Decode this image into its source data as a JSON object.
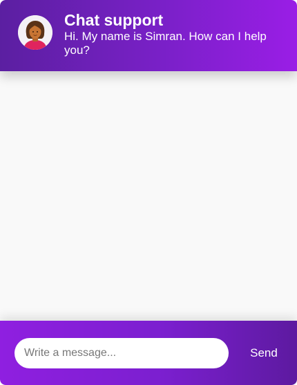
{
  "header": {
    "title": "Chat support",
    "subtitle": "Hi. My name is Simran. How can I help you?",
    "avatar_icon": "woman-avatar-icon"
  },
  "composer": {
    "placeholder": "Write a message...",
    "value": "",
    "send_label": "Send"
  },
  "colors": {
    "header_start": "#5b1fa1",
    "header_end": "#9a1ee6",
    "footer_start": "#8f1fe0",
    "footer_end": "#5d1aa0",
    "message_area": "#f9f9f9"
  }
}
